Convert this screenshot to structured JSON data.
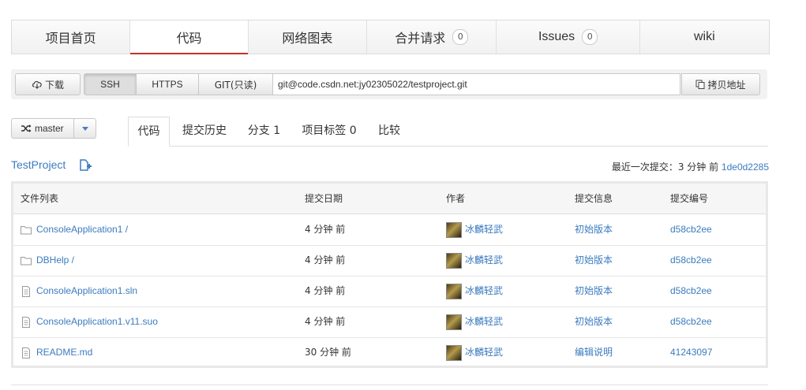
{
  "nav": {
    "items": [
      {
        "label": "项目首页",
        "count": ""
      },
      {
        "label": "代码",
        "count": ""
      },
      {
        "label": "网络图表",
        "count": ""
      },
      {
        "label": "合并请求",
        "count": "0"
      },
      {
        "label": "Issues",
        "count": "0"
      },
      {
        "label": "wiki",
        "count": ""
      }
    ],
    "active": "代码"
  },
  "clone": {
    "download_label": "下载",
    "protocols": [
      "SSH",
      "HTTPS",
      "GIT(只读)"
    ],
    "active_protocol": "SSH",
    "url": "git@code.csdn.net:jy02305022/testproject.git",
    "copy_label": "拷贝地址"
  },
  "branch": {
    "name": "master"
  },
  "subtabs": [
    "代码",
    "提交历史",
    "分支 1",
    "项目标签 0",
    "比较"
  ],
  "project": {
    "name": "TestProject",
    "last_commit_label": "最近一次提交：3 分钟 前",
    "last_commit_hash": "1de0d2285"
  },
  "table": {
    "headers": [
      "文件列表",
      "提交日期",
      "作者",
      "提交信息",
      "提交编号"
    ],
    "rows": [
      {
        "icon": "folder-icon",
        "name": "ConsoleApplication1 /",
        "date": "4 分钟 前",
        "author": "冰麟轻武",
        "message": "初始版本",
        "hash": "d58cb2ee"
      },
      {
        "icon": "folder-icon",
        "name": "DBHelp /",
        "date": "4 分钟 前",
        "author": "冰麟轻武",
        "message": "初始版本",
        "hash": "d58cb2ee"
      },
      {
        "icon": "file-icon",
        "name": "ConsoleApplication1.sln",
        "date": "4 分钟 前",
        "author": "冰麟轻武",
        "message": "初始版本",
        "hash": "d58cb2ee"
      },
      {
        "icon": "file-icon",
        "name": "ConsoleApplication1.v11.suo",
        "date": "4 分钟 前",
        "author": "冰麟轻武",
        "message": "初始版本",
        "hash": "d58cb2ee"
      },
      {
        "icon": "file-icon",
        "name": "README.md",
        "date": "30 分钟 前",
        "author": "冰麟轻武",
        "message": "编辑说明",
        "hash": "41243097"
      }
    ]
  },
  "colors": {
    "accent": "#c9302c",
    "link": "#3b7bbf"
  }
}
